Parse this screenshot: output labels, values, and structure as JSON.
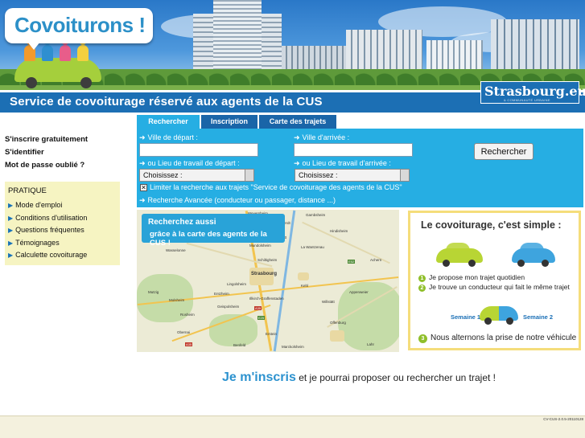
{
  "header": {
    "logo_text": "Covoiturons !",
    "tagline": "Service de covoiturage réservé aux agents de la CUS",
    "partner_logo": "Strasbourg.eu",
    "partner_sub": "& COMMUNAUTÉ URBAINE"
  },
  "left_nav": {
    "links": [
      "S'inscrire gratuitement",
      "S'identifier",
      "Mot de passe oublié ?"
    ]
  },
  "pratique": {
    "title": "PRATIQUE",
    "items": [
      "Mode d'emploi",
      "Conditions d'utilisation",
      "Questions fréquentes",
      "Témoignages",
      "Calculette covoiturage"
    ]
  },
  "tabs": [
    "Rechercher",
    "Inscription",
    "Carte des trajets"
  ],
  "search": {
    "depart_label": "Ville de départ :",
    "arrivee_label": "Ville d'arrivée :",
    "depart_value": "",
    "arrivee_value": "",
    "lieu_depart_label": "ou Lieu de travail de départ :",
    "lieu_arrivee_label": "ou Lieu de travail d'arrivée :",
    "select_depart": "Choisissez :",
    "select_arrivee": "Choisissez :",
    "button": "Rechercher",
    "limit_label": "Limiter la recherche aux trajets \"Service de covoiturage des agents de la CUS\"",
    "limit_checked": true,
    "advanced_link": "Recherche Avancée (conducteur ou passager, distance ...)"
  },
  "map": {
    "callout_line1": "Recherchez aussi",
    "callout_line2": "grâce à la carte des agents de la CUS !",
    "places": [
      "Weyersheim",
      "Hœrdt",
      "Gambsheim",
      "Hindisheim",
      "Mundolsheim",
      "Reichstett",
      "La Wantzenau",
      "Kehl",
      "Strasbourg",
      "Illkirch-Graffenstaden",
      "Geispolsheim",
      "Erstein",
      "Obernai",
      "Molsheim",
      "Mutzig",
      "Rosheim",
      "Offenburg",
      "Lahr",
      "Appenweier",
      "Willstätt",
      "Achern",
      "Wasselonne",
      "Schiltigheim",
      "Lingolsheim",
      "Entzheim",
      "Benfeld",
      "Marckolsheim"
    ]
  },
  "simple": {
    "title": "Le covoiturage, c'est simple :",
    "step1": "Je propose mon trajet quotidien",
    "step2": "Je trouve un conducteur qui fait le même trajet",
    "week1": "Semaine 1",
    "week2": "Semaine 2",
    "step3": "Nous alternons la prise de notre véhicule",
    "num1": "1",
    "num2": "2",
    "num3": "3"
  },
  "bottom": {
    "cta_strong": "Je m'inscris",
    "cta_rest": " et je pourrai proposer ou rechercher un trajet !"
  },
  "footer": {
    "version": "CV-CUS-2.0.5-20110128"
  },
  "colors": {
    "accent": "#26aee3",
    "tab_dark": "#1a65a8",
    "banner_blue": "#1c6fb4",
    "pratique_bg": "#f6f4c2",
    "simple_border": "#f5dd7b"
  }
}
